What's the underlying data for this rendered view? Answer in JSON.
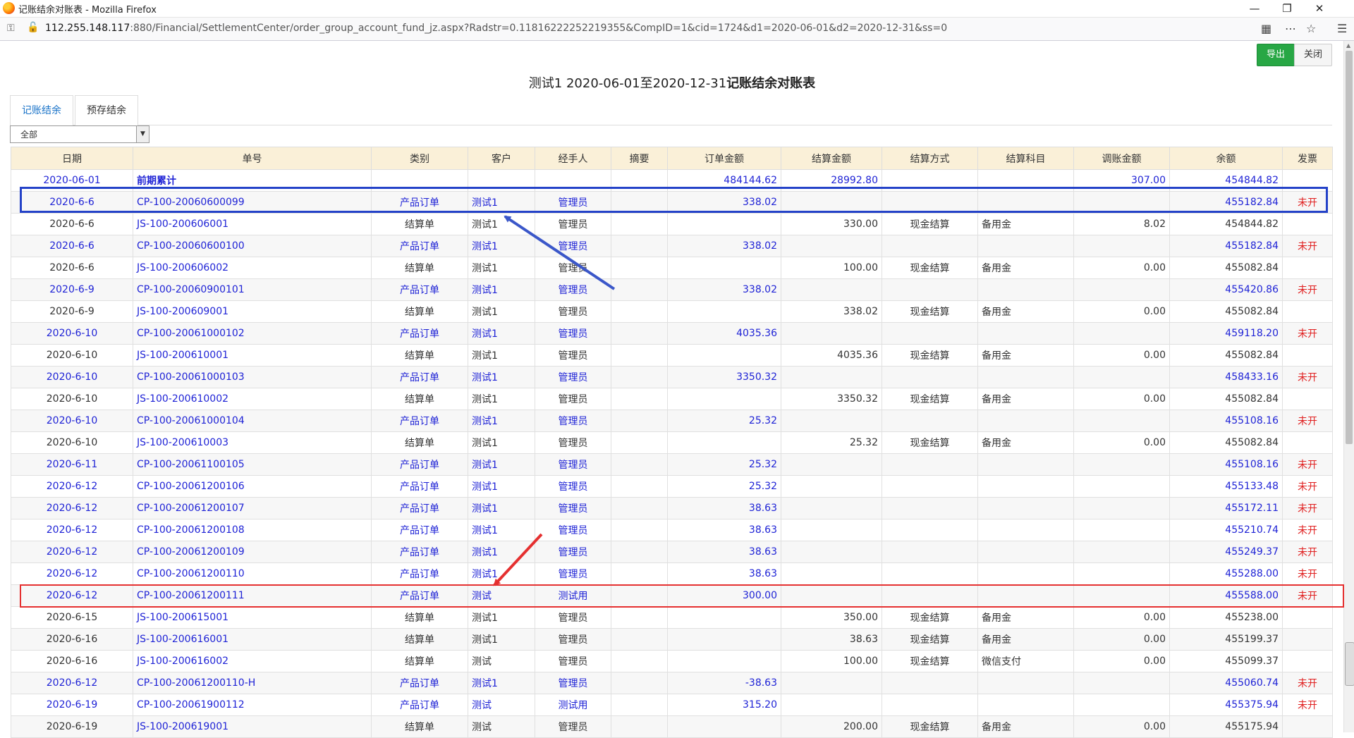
{
  "browser": {
    "window_title": "记账结余对账表 - Mozilla Firefox",
    "url_host": "112.255.148.117",
    "url_rest": ":880/Financial/SettlementCenter/order_group_account_fund_jz.aspx?Radstr=0.11816222252219355&CompID=1&cid=1724&d1=2020-06-01&d2=2020-12-31&ss=0",
    "icons": [
      "firefox-logo",
      "shield-icon",
      "insecure-lock-icon",
      "qr-icon",
      "more-icon",
      "bookmark-star-icon",
      "menu-icon"
    ]
  },
  "toolbar": {
    "export_label": "导出",
    "close_label": "关闭"
  },
  "report": {
    "title_prefix": "测试1 2020-06-01至2020-12-31",
    "title_bold": "记账结余对账表"
  },
  "tabs": [
    {
      "label": "记账结余",
      "active": true
    },
    {
      "label": "预存结余",
      "active": false
    }
  ],
  "filter": {
    "selected": "全部"
  },
  "columns": [
    "日期",
    "单号",
    "类别",
    "客户",
    "经手人",
    "摘要",
    "订单金额",
    "结算金额",
    "结算方式",
    "结算科目",
    "调账金额",
    "余额",
    "发票"
  ],
  "rows": [
    {
      "date": "2020-06-01",
      "no": "前期累计",
      "type": "",
      "customer": "",
      "handler": "",
      "memo": "",
      "order_amt": "484144.62",
      "settle_amt": "28992.80",
      "method": "",
      "subject": "",
      "adjust": "307.00",
      "balance": "454844.82",
      "invoice": "",
      "kind": "summary"
    },
    {
      "date": "2020-6-6",
      "no": "CP-100-20060600099",
      "type": "产品订单",
      "customer": "测试1",
      "handler": "管理员",
      "memo": "",
      "order_amt": "338.02",
      "settle_amt": "",
      "method": "",
      "subject": "",
      "adjust": "",
      "balance": "455182.84",
      "invoice": "未开",
      "kind": "order"
    },
    {
      "date": "2020-6-6",
      "no": "JS-100-200606001",
      "type": "结算单",
      "customer": "测试1",
      "handler": "管理员",
      "memo": "",
      "order_amt": "",
      "settle_amt": "330.00",
      "method": "现金结算",
      "subject": "备用金",
      "adjust": "8.02",
      "balance": "454844.82",
      "invoice": "",
      "kind": "settle"
    },
    {
      "date": "2020-6-6",
      "no": "CP-100-20060600100",
      "type": "产品订单",
      "customer": "测试1",
      "handler": "管理员",
      "memo": "",
      "order_amt": "338.02",
      "settle_amt": "",
      "method": "",
      "subject": "",
      "adjust": "",
      "balance": "455182.84",
      "invoice": "未开",
      "kind": "order"
    },
    {
      "date": "2020-6-6",
      "no": "JS-100-200606002",
      "type": "结算单",
      "customer": "测试1",
      "handler": "管理员",
      "memo": "",
      "order_amt": "",
      "settle_amt": "100.00",
      "method": "现金结算",
      "subject": "备用金",
      "adjust": "0.00",
      "balance": "455082.84",
      "invoice": "",
      "kind": "settle"
    },
    {
      "date": "2020-6-9",
      "no": "CP-100-20060900101",
      "type": "产品订单",
      "customer": "测试1",
      "handler": "管理员",
      "memo": "",
      "order_amt": "338.02",
      "settle_amt": "",
      "method": "",
      "subject": "",
      "adjust": "",
      "balance": "455420.86",
      "invoice": "未开",
      "kind": "order"
    },
    {
      "date": "2020-6-9",
      "no": "JS-100-200609001",
      "type": "结算单",
      "customer": "测试1",
      "handler": "管理员",
      "memo": "",
      "order_amt": "",
      "settle_amt": "338.02",
      "method": "现金结算",
      "subject": "备用金",
      "adjust": "0.00",
      "balance": "455082.84",
      "invoice": "",
      "kind": "settle"
    },
    {
      "date": "2020-6-10",
      "no": "CP-100-20061000102",
      "type": "产品订单",
      "customer": "测试1",
      "handler": "管理员",
      "memo": "",
      "order_amt": "4035.36",
      "settle_amt": "",
      "method": "",
      "subject": "",
      "adjust": "",
      "balance": "459118.20",
      "invoice": "未开",
      "kind": "order"
    },
    {
      "date": "2020-6-10",
      "no": "JS-100-200610001",
      "type": "结算单",
      "customer": "测试1",
      "handler": "管理员",
      "memo": "",
      "order_amt": "",
      "settle_amt": "4035.36",
      "method": "现金结算",
      "subject": "备用金",
      "adjust": "0.00",
      "balance": "455082.84",
      "invoice": "",
      "kind": "settle"
    },
    {
      "date": "2020-6-10",
      "no": "CP-100-20061000103",
      "type": "产品订单",
      "customer": "测试1",
      "handler": "管理员",
      "memo": "",
      "order_amt": "3350.32",
      "settle_amt": "",
      "method": "",
      "subject": "",
      "adjust": "",
      "balance": "458433.16",
      "invoice": "未开",
      "kind": "order"
    },
    {
      "date": "2020-6-10",
      "no": "JS-100-200610002",
      "type": "结算单",
      "customer": "测试1",
      "handler": "管理员",
      "memo": "",
      "order_amt": "",
      "settle_amt": "3350.32",
      "method": "现金结算",
      "subject": "备用金",
      "adjust": "0.00",
      "balance": "455082.84",
      "invoice": "",
      "kind": "settle"
    },
    {
      "date": "2020-6-10",
      "no": "CP-100-20061000104",
      "type": "产品订单",
      "customer": "测试1",
      "handler": "管理员",
      "memo": "",
      "order_amt": "25.32",
      "settle_amt": "",
      "method": "",
      "subject": "",
      "adjust": "",
      "balance": "455108.16",
      "invoice": "未开",
      "kind": "order"
    },
    {
      "date": "2020-6-10",
      "no": "JS-100-200610003",
      "type": "结算单",
      "customer": "测试1",
      "handler": "管理员",
      "memo": "",
      "order_amt": "",
      "settle_amt": "25.32",
      "method": "现金结算",
      "subject": "备用金",
      "adjust": "0.00",
      "balance": "455082.84",
      "invoice": "",
      "kind": "settle"
    },
    {
      "date": "2020-6-11",
      "no": "CP-100-20061100105",
      "type": "产品订单",
      "customer": "测试1",
      "handler": "管理员",
      "memo": "",
      "order_amt": "25.32",
      "settle_amt": "",
      "method": "",
      "subject": "",
      "adjust": "",
      "balance": "455108.16",
      "invoice": "未开",
      "kind": "order"
    },
    {
      "date": "2020-6-12",
      "no": "CP-100-20061200106",
      "type": "产品订单",
      "customer": "测试1",
      "handler": "管理员",
      "memo": "",
      "order_amt": "25.32",
      "settle_amt": "",
      "method": "",
      "subject": "",
      "adjust": "",
      "balance": "455133.48",
      "invoice": "未开",
      "kind": "order"
    },
    {
      "date": "2020-6-12",
      "no": "CP-100-20061200107",
      "type": "产品订单",
      "customer": "测试1",
      "handler": "管理员",
      "memo": "",
      "order_amt": "38.63",
      "settle_amt": "",
      "method": "",
      "subject": "",
      "adjust": "",
      "balance": "455172.11",
      "invoice": "未开",
      "kind": "order"
    },
    {
      "date": "2020-6-12",
      "no": "CP-100-20061200108",
      "type": "产品订单",
      "customer": "测试1",
      "handler": "管理员",
      "memo": "",
      "order_amt": "38.63",
      "settle_amt": "",
      "method": "",
      "subject": "",
      "adjust": "",
      "balance": "455210.74",
      "invoice": "未开",
      "kind": "order"
    },
    {
      "date": "2020-6-12",
      "no": "CP-100-20061200109",
      "type": "产品订单",
      "customer": "测试1",
      "handler": "管理员",
      "memo": "",
      "order_amt": "38.63",
      "settle_amt": "",
      "method": "",
      "subject": "",
      "adjust": "",
      "balance": "455249.37",
      "invoice": "未开",
      "kind": "order"
    },
    {
      "date": "2020-6-12",
      "no": "CP-100-20061200110",
      "type": "产品订单",
      "customer": "测试1",
      "handler": "管理员",
      "memo": "",
      "order_amt": "38.63",
      "settle_amt": "",
      "method": "",
      "subject": "",
      "adjust": "",
      "balance": "455288.00",
      "invoice": "未开",
      "kind": "order"
    },
    {
      "date": "2020-6-12",
      "no": "CP-100-20061200111",
      "type": "产品订单",
      "customer": "测试",
      "handler": "测试用",
      "memo": "",
      "order_amt": "300.00",
      "settle_amt": "",
      "method": "",
      "subject": "",
      "adjust": "",
      "balance": "455588.00",
      "invoice": "未开",
      "kind": "order"
    },
    {
      "date": "2020-6-15",
      "no": "JS-100-200615001",
      "type": "结算单",
      "customer": "测试1",
      "handler": "管理员",
      "memo": "",
      "order_amt": "",
      "settle_amt": "350.00",
      "method": "现金结算",
      "subject": "备用金",
      "adjust": "0.00",
      "balance": "455238.00",
      "invoice": "",
      "kind": "settle"
    },
    {
      "date": "2020-6-16",
      "no": "JS-100-200616001",
      "type": "结算单",
      "customer": "测试1",
      "handler": "管理员",
      "memo": "",
      "order_amt": "",
      "settle_amt": "38.63",
      "method": "现金结算",
      "subject": "备用金",
      "adjust": "0.00",
      "balance": "455199.37",
      "invoice": "",
      "kind": "settle"
    },
    {
      "date": "2020-6-16",
      "no": "JS-100-200616002",
      "type": "结算单",
      "customer": "测试",
      "handler": "管理员",
      "memo": "",
      "order_amt": "",
      "settle_amt": "100.00",
      "method": "现金结算",
      "subject": "微信支付",
      "adjust": "0.00",
      "balance": "455099.37",
      "invoice": "",
      "kind": "settle"
    },
    {
      "date": "2020-6-12",
      "no": "CP-100-20061200110-H",
      "type": "产品订单",
      "customer": "测试1",
      "handler": "管理员",
      "memo": "",
      "order_amt": "-38.63",
      "settle_amt": "",
      "method": "",
      "subject": "",
      "adjust": "",
      "balance": "455060.74",
      "invoice": "未开",
      "kind": "order"
    },
    {
      "date": "2020-6-19",
      "no": "CP-100-20061900112",
      "type": "产品订单",
      "customer": "测试",
      "handler": "测试用",
      "memo": "",
      "order_amt": "315.20",
      "settle_amt": "",
      "method": "",
      "subject": "",
      "adjust": "",
      "balance": "455375.94",
      "invoice": "未开",
      "kind": "order"
    },
    {
      "date": "2020-6-19",
      "no": "JS-100-200619001",
      "type": "结算单",
      "customer": "测试",
      "handler": "管理员",
      "memo": "",
      "order_amt": "",
      "settle_amt": "200.00",
      "method": "现金结算",
      "subject": "备用金",
      "adjust": "0.00",
      "balance": "455175.94",
      "invoice": "",
      "kind": "settle"
    }
  ],
  "colors": {
    "link_blue": "#1f23d6",
    "invoice_red": "#e02020",
    "header_bg": "#faf0d8",
    "export_green": "#28a745",
    "highlight_blue": "#2442c8",
    "highlight_red": "#e53030"
  }
}
